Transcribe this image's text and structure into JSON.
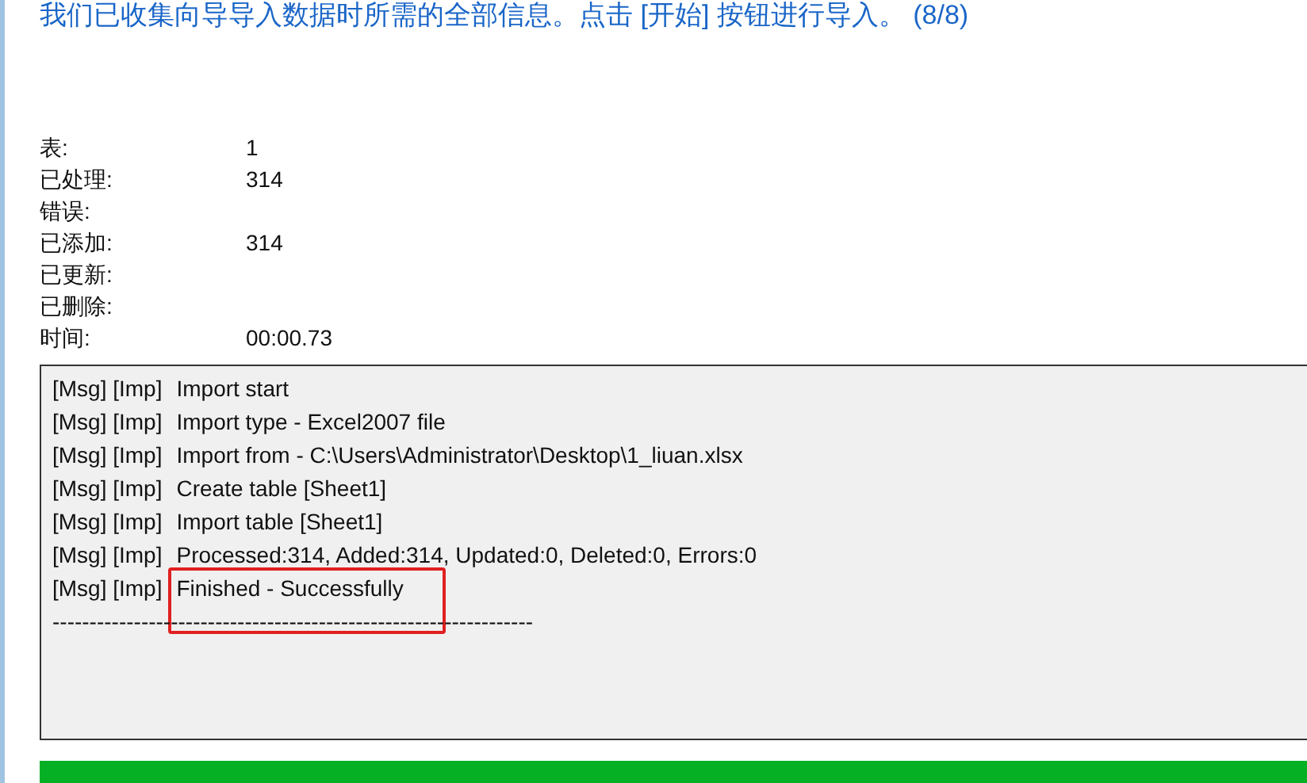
{
  "header": "我们已收集向导导入数据时所需的全部信息。点击 [开始] 按钮进行导入。 (8/8)",
  "stats": [
    {
      "label": "表:",
      "value": "1"
    },
    {
      "label": "已处理:",
      "value": "314"
    },
    {
      "label": "错误:"
    },
    {
      "label": "已添加:",
      "value": "314"
    },
    {
      "label": "已更新:"
    },
    {
      "label": "已删除:"
    },
    {
      "label": "时间:",
      "value": "00:00.73"
    }
  ],
  "log": [
    {
      "source": "[Msg] [Imp]",
      "message": "Import start",
      "highlighted": false
    },
    {
      "source": "[Msg] [Imp]",
      "message": "Import type - Excel2007 file",
      "highlighted": false
    },
    {
      "source": "[Msg] [Imp]",
      "message": "Import from - C:\\Users\\Administrator\\Desktop\\1_liuan.xlsx",
      "highlighted": false
    },
    {
      "source": "[Msg] [Imp]",
      "message": "Create table [Sheet1]",
      "highlighted": false
    },
    {
      "source": "[Msg] [Imp]",
      "message": "Import table [Sheet1]",
      "highlighted": false
    },
    {
      "source": "[Msg] [Imp]",
      "message": "Processed:314, Added:314, Updated:0, Deleted:0, Errors:0",
      "highlighted": false
    },
    {
      "source": "[Msg] [Imp]",
      "message": "Finished - Successfully",
      "highlighted": true
    },
    {
      "message": "-----------------------------------------------------------------",
      "highlighted": false
    }
  ],
  "progress": {
    "level": 1
  }
}
